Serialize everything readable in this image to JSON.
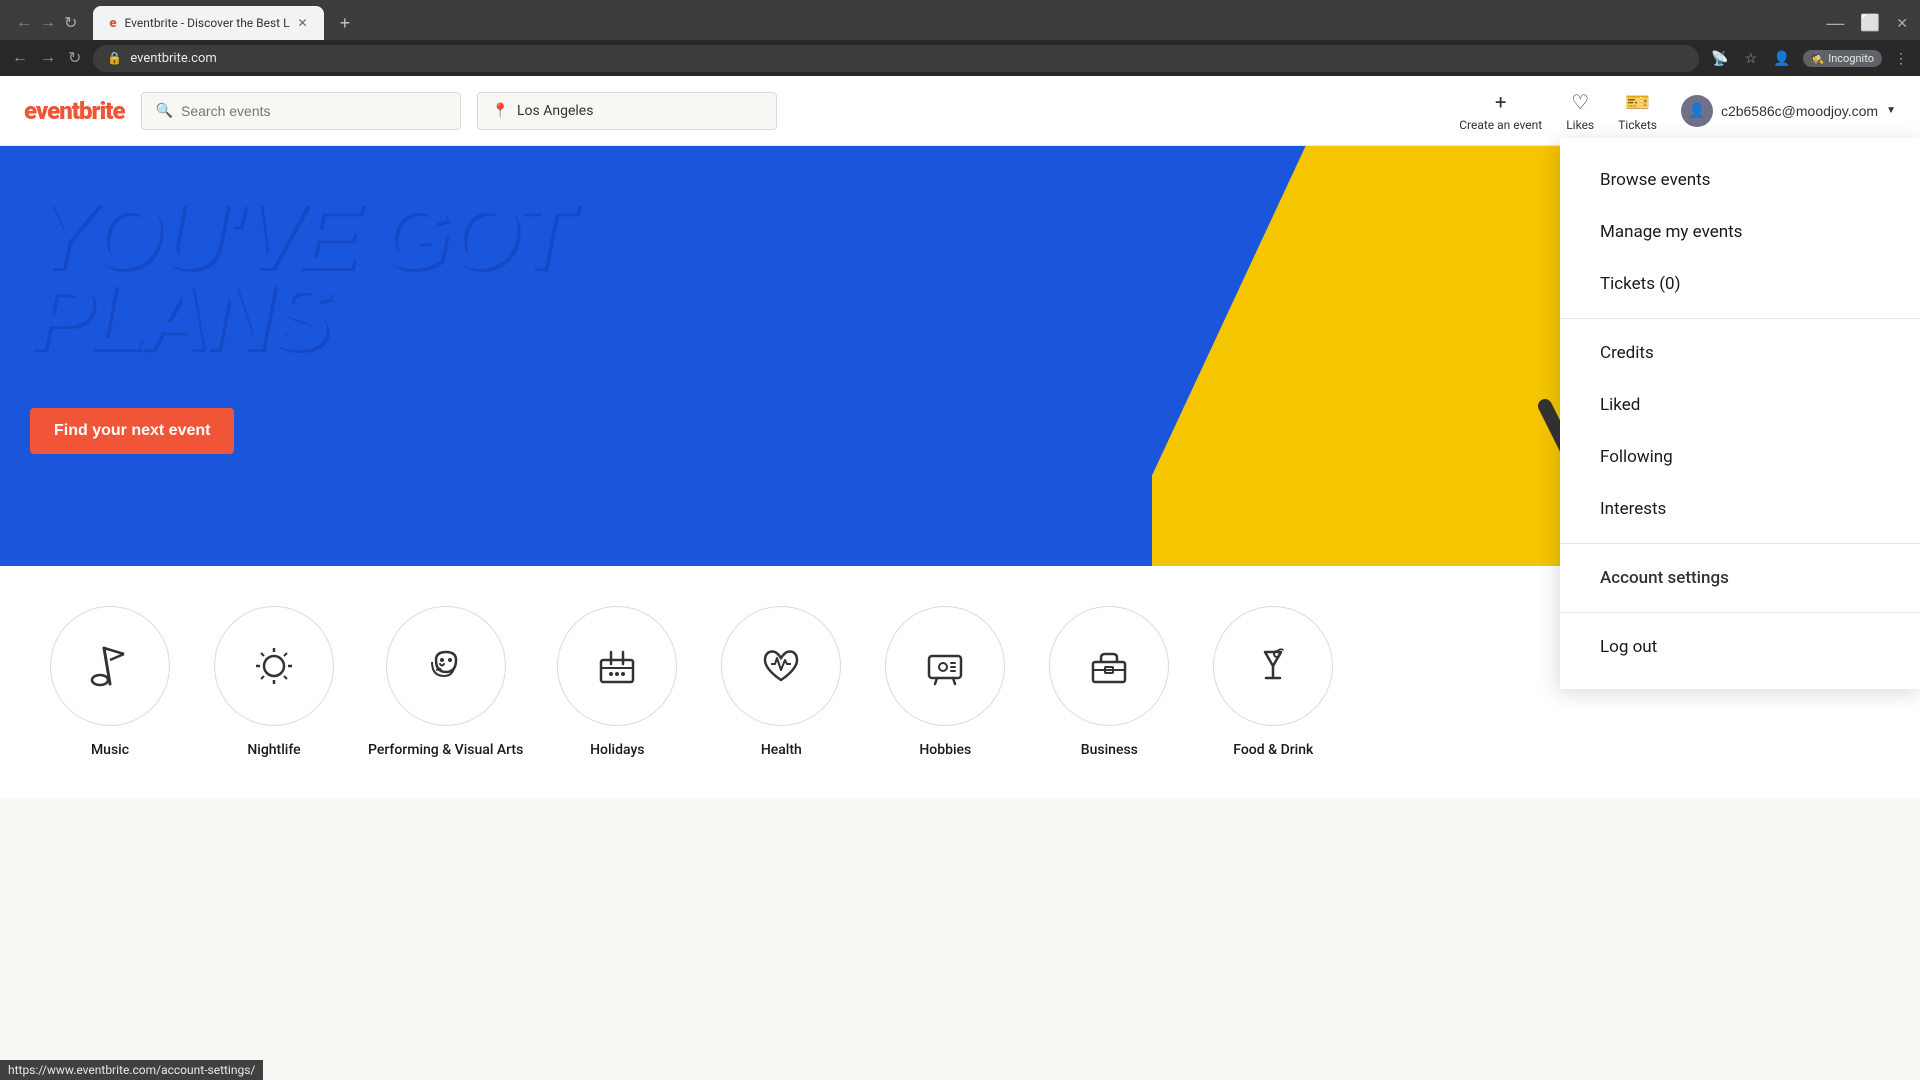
{
  "browser": {
    "tab_title": "Eventbrite - Discover the Best L",
    "url": "eventbrite.com",
    "favicon": "e",
    "incognito_label": "Incognito"
  },
  "header": {
    "logo_text": "eventbrite",
    "search_placeholder": "Search events",
    "location_value": "Los Angeles",
    "create_label": "Create an event",
    "likes_label": "Likes",
    "tickets_label": "Tickets",
    "user_email": "c2b6586c@moodjoy.com"
  },
  "hero": {
    "line1": "YOU'VE GOT",
    "line2": "PLANS",
    "cta_label": "Find your next event"
  },
  "dropdown": {
    "items": [
      {
        "id": "browse-events",
        "label": "Browse events"
      },
      {
        "id": "manage-events",
        "label": "Manage my events"
      },
      {
        "id": "tickets",
        "label": "Tickets (0)"
      },
      {
        "id": "credits",
        "label": "Credits"
      },
      {
        "id": "liked",
        "label": "Liked"
      },
      {
        "id": "following",
        "label": "Following"
      },
      {
        "id": "interests",
        "label": "Interests"
      },
      {
        "id": "account-settings",
        "label": "Account settings"
      },
      {
        "id": "log-out",
        "label": "Log out"
      }
    ]
  },
  "categories": [
    {
      "id": "music",
      "name": "Music",
      "icon": "🎤"
    },
    {
      "id": "nightlife",
      "name": "Nightlife",
      "icon": "🪩"
    },
    {
      "id": "performing-visual-arts",
      "name": "Performing & Visual Arts",
      "icon": "🎭"
    },
    {
      "id": "holidays",
      "name": "Holidays",
      "icon": "🎉"
    },
    {
      "id": "health",
      "name": "Health",
      "icon": "🫀"
    },
    {
      "id": "hobbies",
      "name": "Hobbies",
      "icon": "🎮"
    },
    {
      "id": "business",
      "name": "Business",
      "icon": "💼"
    },
    {
      "id": "food-drink",
      "name": "Food & Drink",
      "icon": "🍹"
    }
  ],
  "status_bar": {
    "url": "https://www.eventbrite.com/account-settings/"
  },
  "colors": {
    "brand_orange": "#f05537",
    "brand_blue": "#1d63ed",
    "hero_yellow": "#f5c500"
  }
}
